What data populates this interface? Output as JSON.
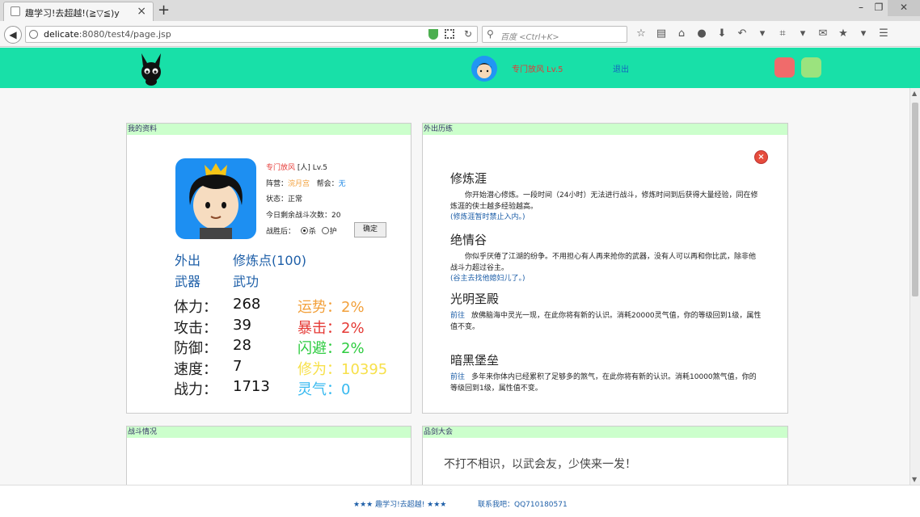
{
  "browser": {
    "tab_title": "趣学习!去超越!(≧▽≦)y",
    "tab_close": "×",
    "new_tab": "+",
    "url_host": "delicate",
    "url_rest": ":8080/test4/page.jsp",
    "search_placeholder": "百度 <Ctrl+K>"
  },
  "header": {
    "user_label": "专门放风 Lv.5",
    "logout": "退出"
  },
  "profile": {
    "section_title": "我的资料",
    "name": "专门放风",
    "race": "[人]",
    "level": "Lv.5",
    "faction_label": "阵营：",
    "faction": "浣月宫",
    "guild_label": "帮会：",
    "guild": "无",
    "status_label": "状态：",
    "status": "正常",
    "battles_label": "今日剩余战斗次数：",
    "battles": "20",
    "after_win_label": "战胜后：",
    "opt_kill": "杀",
    "opt_protect": "护",
    "confirm": "确定",
    "links": {
      "out": "外出",
      "cultivation": "修炼点(100)",
      "weapon": "武器",
      "skill": "武功"
    },
    "stats": {
      "hp_label": "体力：",
      "hp": "268",
      "luck_label": "运势：",
      "luck": "2%",
      "atk_label": "攻击：",
      "atk": "39",
      "crit_label": "暴击：",
      "crit": "2%",
      "def_label": "防御：",
      "def": "28",
      "dodge_label": "闪避：",
      "dodge": "2%",
      "spd_label": "速度：",
      "spd": "7",
      "cult_label": "修为：",
      "cult": "10395",
      "power_label": "战力：",
      "power": "1713",
      "qi_label": "灵气：",
      "qi": "0"
    },
    "colors": {
      "luck": "#f2a03b",
      "crit": "#e53935",
      "dodge": "#2ecc40",
      "cult": "#f7e04a",
      "qi": "#36b9f0"
    }
  },
  "training": {
    "section_title": "外出历练",
    "close_icon": "×",
    "items": [
      {
        "title": "修炼涯",
        "desc": "　　你开始潜心修炼。一段时间（24小时）无法进行战斗，修炼时间到后获得大量经验，同在修炼涯的侠士越多经验越高。",
        "note": "(修炼涯暂时禁止入内。)"
      },
      {
        "title": "绝情谷",
        "desc": "　　你似乎厌倦了江湖的纷争。不用担心有人再来抢你的武器，没有人可以再和你比武，除非他战斗力超过谷主。",
        "note": "(谷主去找他媳妇儿了。)"
      },
      {
        "title": "光明圣殿",
        "go": "前往",
        "desc": "放佛脑海中灵光一现，在此你将有新的认识。消耗20000灵气值，你的等级回到1级，属性值不变。"
      },
      {
        "title": "暗黑堡垒",
        "go": "前往",
        "desc": "多年来你体内已经累积了足够多的煞气，在此你将有新的认识。消耗10000煞气值，你的等级回到1级，属性值不变。"
      }
    ]
  },
  "battle": {
    "section_title": "战斗情况"
  },
  "sword": {
    "section_title": "品剑大会",
    "text": "不打不相识，以武会友，少侠来一发！"
  },
  "footer": {
    "slogan": "★★★ 趣学习!去超越! ★★★",
    "contact": "联系我吧：QQ710180571"
  }
}
